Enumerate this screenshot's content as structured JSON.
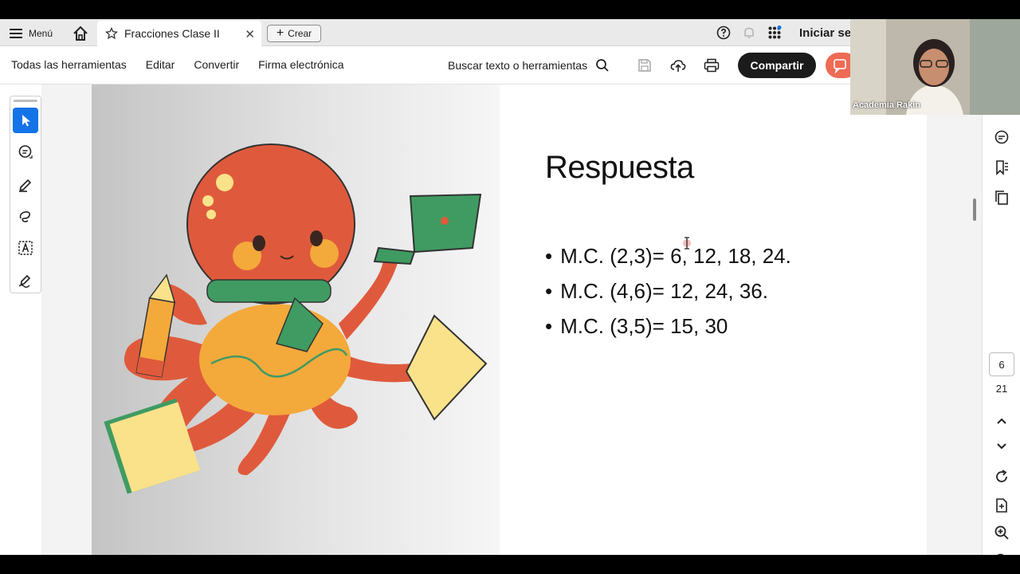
{
  "tabbar": {
    "menu_label": "Menú",
    "tab_title": "Fracciones Clase II",
    "create_label": "Crear",
    "signin_label": "Iniciar se"
  },
  "toolbar": {
    "items": [
      "Todas las herramientas",
      "Editar",
      "Convertir",
      "Firma electrónica"
    ],
    "search_label": "Buscar texto o herramientas",
    "share_label": "Compartir"
  },
  "slide": {
    "title": "Respuesta",
    "bullets": [
      "M.C. (2,3)= 6, 12, 18, 24.",
      "M.C. (4,6)= 12, 24, 36.",
      "M.C. (3,5)= 15, 30"
    ]
  },
  "pagination": {
    "current": "6",
    "total": "21"
  },
  "webcam": {
    "name": "Academia Rakin"
  },
  "colors": {
    "accent": "#1473e6",
    "share_bg": "#1b1b1b",
    "extra_btn": "#ee6b55",
    "octopus": "#df5a3c",
    "scarf": "#3f9b62",
    "body": "#f4a93b"
  }
}
